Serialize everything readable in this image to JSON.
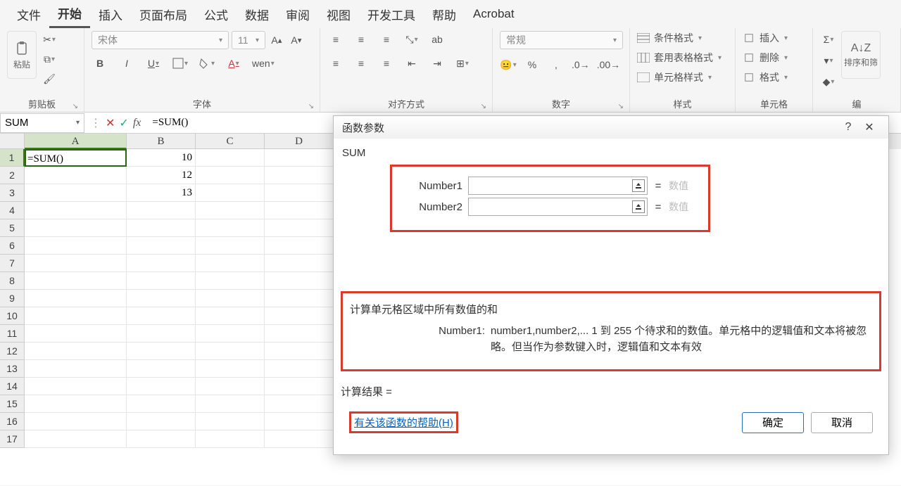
{
  "ribbon": {
    "tabs": [
      "文件",
      "开始",
      "插入",
      "页面布局",
      "公式",
      "数据",
      "审阅",
      "视图",
      "开发工具",
      "帮助",
      "Acrobat"
    ],
    "active_tab_index": 1,
    "clipboard": {
      "paste": "粘贴",
      "label": "剪贴板"
    },
    "font": {
      "name": "宋体",
      "size": "11",
      "bold": "B",
      "italic": "I",
      "underline": "U",
      "phonetic": "wen",
      "label": "字体"
    },
    "alignment": {
      "wrap": "ab",
      "label": "对齐方式"
    },
    "number": {
      "format": "常规",
      "label": "数字"
    },
    "styles": {
      "cond": "条件格式",
      "table": "套用表格格式",
      "cell": "单元格样式",
      "label": "样式"
    },
    "cells": {
      "insert": "插入",
      "delete": "删除",
      "format": "格式",
      "label": "单元格"
    },
    "editing": {
      "sort": "排序和筛",
      "label": "编"
    }
  },
  "formulaBar": {
    "nameBox": "SUM",
    "formula": "=SUM()"
  },
  "grid": {
    "columns": [
      "A",
      "B",
      "C",
      "D"
    ],
    "rows": [
      1,
      2,
      3,
      4,
      5,
      6,
      7,
      8,
      9,
      10,
      11,
      12,
      13,
      14,
      15,
      16,
      17
    ],
    "activeCell": "A1",
    "cells": {
      "A1": "=SUM()",
      "B1": "10",
      "B2": "12",
      "B3": "13"
    }
  },
  "dialog": {
    "title": "函数参数",
    "fn": "SUM",
    "args": [
      {
        "label": "Number1",
        "value": "",
        "hint": "数值"
      },
      {
        "label": "Number2",
        "value": "",
        "hint": "数值"
      }
    ],
    "description": "计算单元格区域中所有数值的和",
    "paramName": "Number1:",
    "paramDesc": "number1,number2,... 1 到 255 个待求和的数值。单元格中的逻辑值和文本将被忽略。但当作为参数键入时，逻辑值和文本有效",
    "resultLabel": "计算结果 =",
    "helpLink": "有关该函数的帮助(H)",
    "ok": "确定",
    "cancel": "取消"
  }
}
